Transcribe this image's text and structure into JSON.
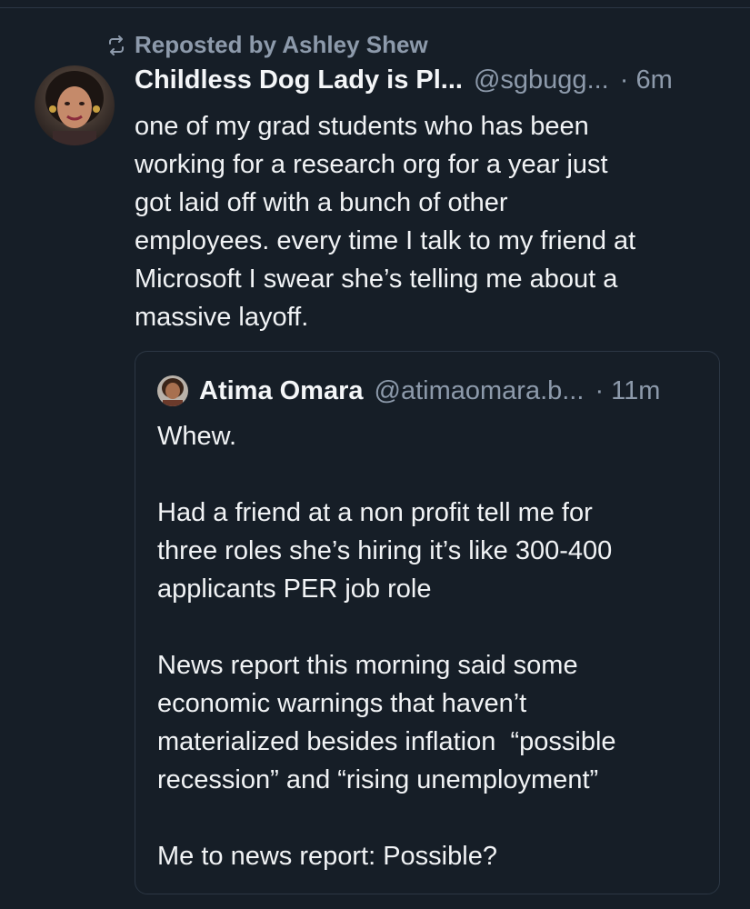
{
  "repost": {
    "label": "Reposted by Ashley Shew",
    "icon": "repost-icon"
  },
  "post": {
    "display_name": "Childless Dog Lady is Pl...",
    "handle": "@sgbugg...",
    "time": "· 6m",
    "text": "one of my grad students who has been\nworking for a research org for a year just\ngot laid off with a bunch of other\nemployees. every time I talk to my friend at\nMicrosoft I swear she’s telling me about a\nmassive layoff."
  },
  "quote": {
    "display_name": "Atima Omara",
    "handle": "@atimaomara.b...",
    "time": "· 11m",
    "text": "Whew.\n\nHad a friend at a non profit tell me for\nthree roles she’s hiring it’s like 300-400\napplicants PER job role\n\nNews report this morning said some\neconomic warnings that haven’t\nmaterialized besides inflation  “possible\nrecession” and “rising unemployment”\n\nMe to news report: Possible?"
  },
  "colors": {
    "background": "#161e27",
    "muted_text": "#8d9aab",
    "primary_text": "#f1f3f5",
    "border": "#2c3744"
  }
}
